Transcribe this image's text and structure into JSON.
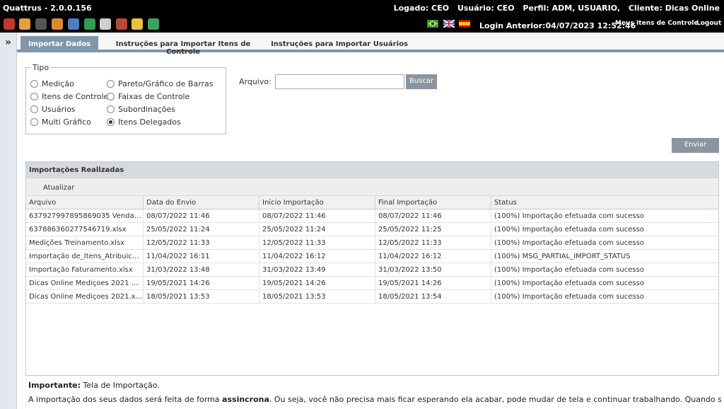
{
  "header": {
    "app_title": "Quattrus - 2.0.0.156",
    "logado_label": "Logado:",
    "logado_value": "CEO",
    "usuario_label": "Usuário:",
    "usuario_value": "CEO",
    "perfil_label": "Perfil:",
    "perfil_value": "ADM, USUARIO,",
    "cliente_label": "Cliente:",
    "cliente_value": "Dicas Online"
  },
  "toolbar": {
    "icons": [
      "settings-tool-icon",
      "users-icon",
      "calendar-icon",
      "hierarchy-icon",
      "report-icon",
      "excel-icon",
      "printer-icon",
      "book-icon",
      "help-icon",
      "export-icon"
    ],
    "flags": [
      "brazil-flag-icon",
      "uk-flag-icon",
      "spain-flag-icon"
    ],
    "login_anterior": "Login Anterior:04/07/2023 12:52:46",
    "meus_itens": "Meus Itens de Controle",
    "logout": "Logout"
  },
  "sidebar": {
    "expand": "»"
  },
  "tabs": [
    {
      "label": "Importar Dados",
      "active": true
    },
    {
      "label": "Instruções para Importar Itens de Controle",
      "active": false
    },
    {
      "label": "Instruções para Importar Usuários",
      "active": false
    }
  ],
  "tipo": {
    "legend": "Tipo",
    "options": [
      {
        "label": "Medição",
        "checked": false
      },
      {
        "label": "Itens de Controle",
        "checked": false
      },
      {
        "label": "Usuários",
        "checked": false
      },
      {
        "label": "Multi Gráfico",
        "checked": false
      },
      {
        "label": "Pareto/Gráfico de Barras",
        "checked": false
      },
      {
        "label": "Faixas de Controle",
        "checked": false
      },
      {
        "label": "Subordinações",
        "checked": false
      },
      {
        "label": "Itens Delegados",
        "checked": true
      }
    ]
  },
  "upload": {
    "label": "Arquivo:",
    "value": "",
    "buscar": "Buscar",
    "enviar": "Enviar"
  },
  "importacoes": {
    "title": "Importações Realizadas",
    "atualizar": "Atualizar",
    "columns": [
      "Arquivo",
      "Data do Envio",
      "Início Importação",
      "Final Importação",
      "Status"
    ],
    "rows": [
      [
        "637927997895869035 Vendas I...",
        "08/07/2022 11:46",
        "08/07/2022 11:46",
        "08/07/2022 11:46",
        "(100%) Importação efetuada com sucesso"
      ],
      [
        "637886360277546719.xlsx",
        "25/05/2022 11:24",
        "25/05/2022 11:24",
        "25/05/2022 11:25",
        "(100%) Importação efetuada com sucesso"
      ],
      [
        "Medições Treinamento.xlsx",
        "12/05/2022 11:33",
        "12/05/2022 11:33",
        "12/05/2022 11:33",
        "(100%) Importação efetuada com sucesso"
      ],
      [
        "Importação de_Itens_Atribuicao...",
        "11/04/2022 16:11",
        "11/04/2022 16:12",
        "11/04/2022 16:12",
        "(100%) MSG_PARTIAL_IMPORT_STATUS"
      ],
      [
        "Importação Faturamento.xlsx",
        "31/03/2022 13:48",
        "31/03/2022 13:49",
        "31/03/2022 13:50",
        "(100%) Importação efetuada com sucesso"
      ],
      [
        "Dicas Online Mediçoes 2021 Co...",
        "19/05/2021 14:26",
        "19/05/2021 14:26",
        "19/05/2021 14:26",
        "(100%) Importação efetuada com sucesso"
      ],
      [
        "Dicas Online Mediçoes 2021.xlsx",
        "18/05/2021 13:53",
        "18/05/2021 13:53",
        "18/05/2021 13:54",
        "(100%) Importação efetuada com sucesso"
      ]
    ]
  },
  "note": {
    "important_label": "Importante:",
    "important_text": " Tela de Importação.",
    "line2_a": "A importação dos seus dados será feita de forma ",
    "line2_bold": "assincrona",
    "line2_b": ". Ou seja, você não precisa mais ficar esperando ela acabar, pode mudar de tela e continuar trabalhando. Quando sua importação"
  }
}
